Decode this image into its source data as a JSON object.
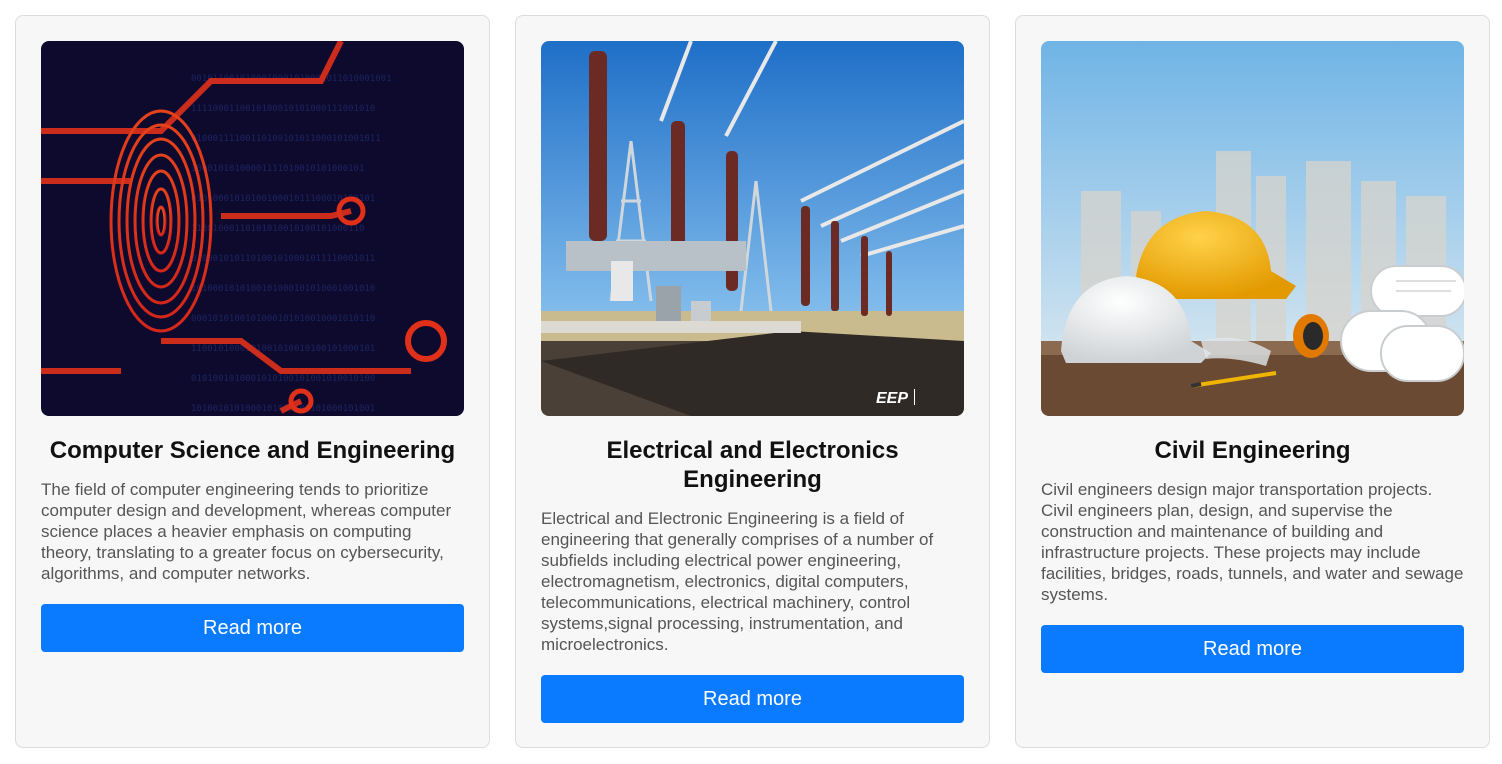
{
  "cards": [
    {
      "title": "Computer Science and Engineering",
      "description": "The field of computer engineering tends to prioritize computer design and development, whereas computer science places a heavier emphasis on computing theory, translating to a greater focus on cybersecurity, algorithms, and computer networks.",
      "button_label": "Read more",
      "image": "fingerprint-circuit-image"
    },
    {
      "title": "Electrical and Electronics Engineering",
      "description": "Electrical and Electronic Engineering is a field of engineering that generally comprises of a number of subfields including electrical power engineering, electromagnetism, electronics, digital computers, telecommunications, electrical machinery, control systems,signal processing, instrumentation, and microelectronics.",
      "button_label": "Read more",
      "image": "power-substation-image",
      "image_watermark": "EEP"
    },
    {
      "title": "Civil Engineering",
      "description": "Civil engineers design major transportation projects. Civil engineers plan, design, and supervise the construction and maintenance of building and infrastructure projects. These projects may include facilities, bridges, roads, tunnels, and water and sewage systems.",
      "button_label": "Read more",
      "image": "hard-hats-blueprints-image"
    }
  ],
  "colors": {
    "button": "#0a7bff",
    "card_background": "#f7f7f7",
    "title": "#111111",
    "description": "#555555"
  }
}
